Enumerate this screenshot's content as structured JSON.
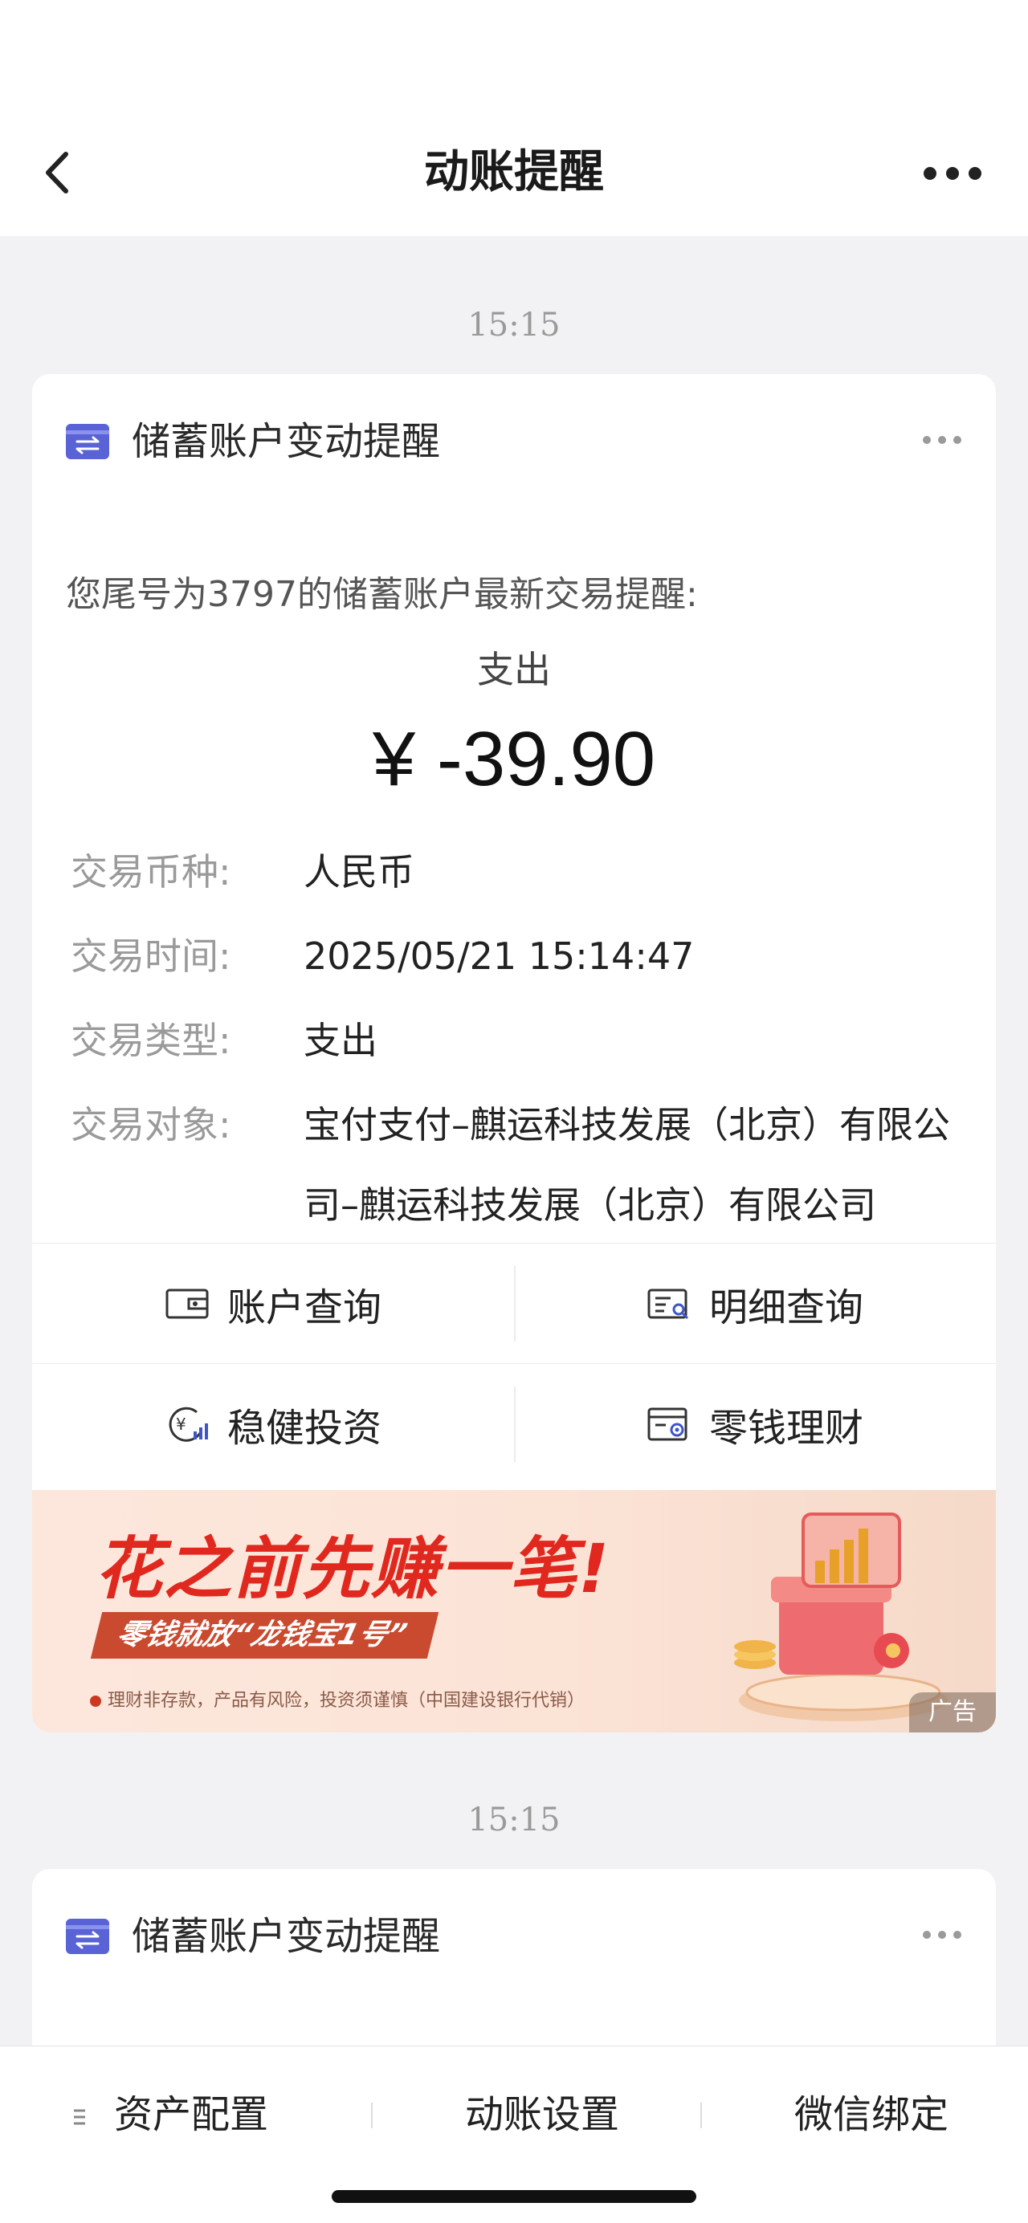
{
  "header": {
    "title": "动账提醒",
    "back_icon": "chevron-left-icon",
    "more_icon": "ellipsis-icon"
  },
  "messages": [
    {
      "time": "15:15",
      "card_title": "储蓄账户变动提醒",
      "intro": "您尾号为3797的储蓄账户最新交易提醒:",
      "kind": "支出",
      "amount": "¥ -39.90",
      "fields": [
        {
          "label": "交易币种:",
          "value": "人民币"
        },
        {
          "label": "交易时间:",
          "value": "2025/05/21 15:14:47"
        },
        {
          "label": "交易类型:",
          "value": "支出"
        },
        {
          "label": "交易对象:",
          "value": "宝付支付–麒运科技发展（北京）有限公司–麒运科技发展（北京）有限公司"
        }
      ],
      "actions": [
        {
          "label": "账户查询",
          "icon": "wallet-icon"
        },
        {
          "label": "明细查询",
          "icon": "detail-search-icon"
        },
        {
          "label": "稳健投资",
          "icon": "yuan-growth-icon"
        },
        {
          "label": "零钱理财",
          "icon": "finance-card-icon"
        }
      ],
      "banner": {
        "headline": "花之前先赚一笔!",
        "sub": "零钱就放“龙钱宝1号”",
        "disclaimer": "理财非存款，产品有风险，投资须谨慎（中国建设银行代销）",
        "ad_label": "广告"
      }
    },
    {
      "time": "15:15",
      "card_title": "储蓄账户变动提醒"
    }
  ],
  "bottom_tabs": [
    {
      "label": "资产配置"
    },
    {
      "label": "动账设置"
    },
    {
      "label": "微信绑定"
    }
  ],
  "colors": {
    "accent": "#5a63d6",
    "banner_red": "#e0281f",
    "background": "#f2f2f4"
  }
}
